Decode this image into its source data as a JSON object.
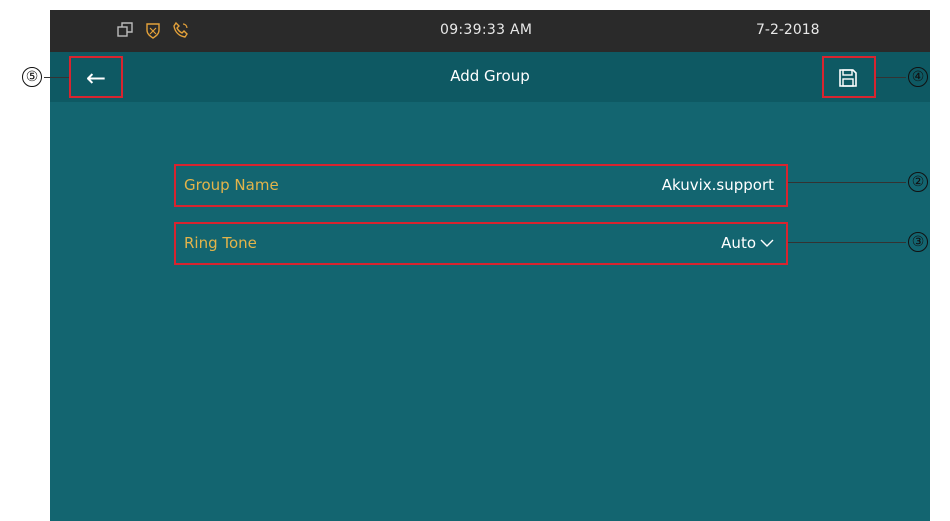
{
  "status_bar": {
    "time": "09:39:33  AM",
    "date": "7-2-2018",
    "icons": [
      "window-icon",
      "shield-icon",
      "phone-icon"
    ]
  },
  "header": {
    "title": "Add Group",
    "back_icon": "arrow-left-icon",
    "save_icon": "save-floppy-icon"
  },
  "form": {
    "group_name": {
      "label": "Group Name",
      "value": "Akuvix.support"
    },
    "ring_tone": {
      "label": "Ring Tone",
      "value": "Auto"
    }
  },
  "callouts": [
    "⑤",
    "④",
    "②",
    "③"
  ],
  "colors": {
    "screen_bg": "#136570",
    "title_bg": "#0e5963",
    "status_bg": "#2a2a2a",
    "label": "#e3b44a",
    "highlight": "#d8242f"
  }
}
